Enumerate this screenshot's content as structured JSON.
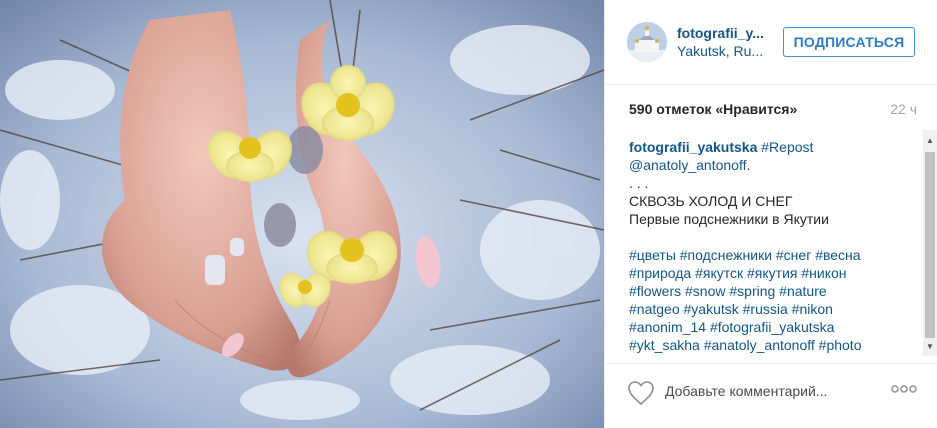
{
  "post": {
    "photo_icon": "photo-image"
  },
  "header": {
    "username": "fotografii_y...",
    "location": "Yakutsk, Ru...",
    "follow_label": "ПОДПИСАТЬСЯ",
    "avatar_icon": "church-avatar"
  },
  "stats": {
    "likes": "590 отметок «Нравится»",
    "time": "22 ч"
  },
  "caption": {
    "author": "fotografii_yakutska",
    "repost_tag": "#Repost",
    "mention": "@anatoly_antonoff",
    "mention_suffix": ".",
    "dots": ". . .",
    "title": "СКВОЗЬ ХОЛОД И СНЕГ",
    "subtitle": "Первые подснежники в Якутии",
    "hashtag_lines": [
      "#цветы #подснежники #снег #весна",
      "#природа #якутск #якутия #никон",
      "#flowers #snow #spring #nature",
      "#natgeo #yakutsk #russia #nikon",
      "#anonim_14 #fotografii_yakutska",
      "#ykt_sakha #anatoly_antonoff #photo"
    ]
  },
  "scrollbar": {
    "up_glyph": "▲",
    "down_glyph": "▼"
  },
  "footer": {
    "comment_placeholder": "Добавьте комментарий...",
    "heart_icon": "heart-icon",
    "more_icon": "more-options-icon"
  },
  "colors": {
    "link": "#125688",
    "follow_border": "#4090db",
    "muted": "#a5a7aa",
    "text": "#262626"
  }
}
